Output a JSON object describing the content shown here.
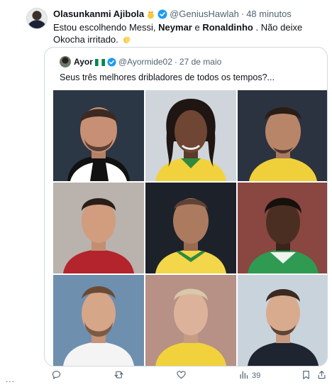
{
  "tweet": {
    "author_name": "Olasunkanmi Ajibola",
    "handle": "@GeniusHawlah",
    "separator": "·",
    "time": "48 minutos",
    "text_part1": "Estou escolhendo Messi,",
    "bold1": "Neymar",
    "text_part2": "e",
    "bold2": "Ronaldinho",
    "text_part3": ". Não deixe Okocha irritado.",
    "author_emoji_icon": "crown-person-emoji-icon",
    "text_emoji_icon": "clapping-hands-emoji-icon"
  },
  "quote": {
    "author_name": "Ayor",
    "flag_icon": "nigeria-flag-icon",
    "handle": "@Ayormide02",
    "separator": "·",
    "time": "27 de maio",
    "text": "Seus três melhores dribladores de todos os tempos?..."
  },
  "actions": {
    "reply_icon": "reply-icon",
    "retweet_icon": "retweet-icon",
    "like_icon": "heart-icon",
    "views_icon": "views-icon",
    "views_count": "39",
    "bookmark_icon": "bookmark-icon",
    "share_icon": "share-icon"
  },
  "sidebar_ellipsis": "..."
}
